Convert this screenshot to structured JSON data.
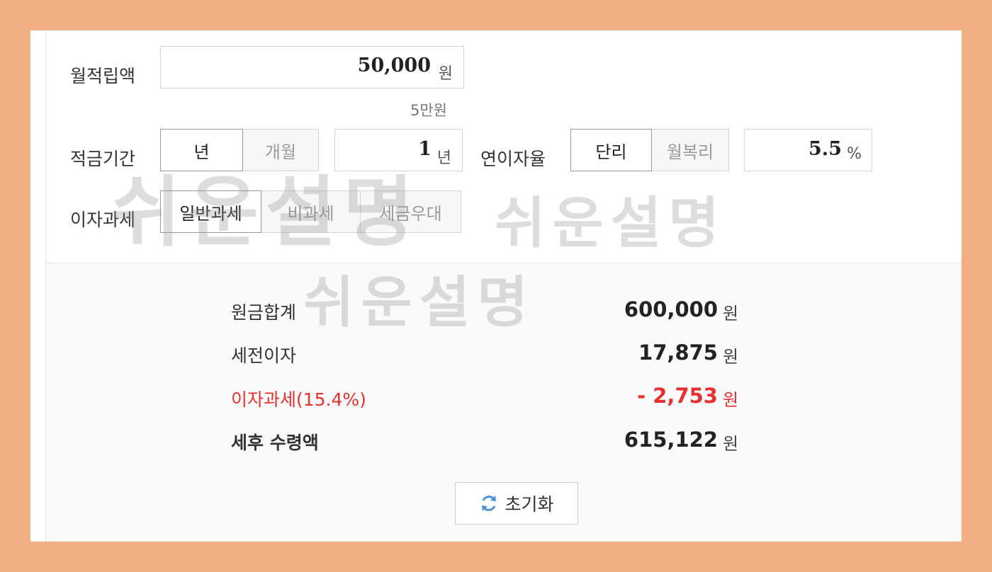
{
  "form": {
    "monthly_label": "월적립액",
    "monthly_value": "50,000",
    "monthly_unit": "원",
    "monthly_hint": "5만원",
    "period_label": "적금기간",
    "period_unit_options": [
      "년",
      "개월"
    ],
    "period_value": "1",
    "period_unit": "년",
    "rate_label": "연이자율",
    "rate_type_options": [
      "단리",
      "월복리"
    ],
    "rate_value": "5.5",
    "rate_unit": "%",
    "tax_label": "이자과세",
    "tax_options": [
      "일반과세",
      "비과세",
      "세금우대"
    ]
  },
  "results": {
    "principal_label": "원금합계",
    "principal_value": "600,000",
    "pretax_label": "세전이자",
    "pretax_value": "17,875",
    "tax_label": "이자과세(15.4%)",
    "tax_value": "- 2,753",
    "after_label": "세후 수령액",
    "after_value": "615,122",
    "unit": "원"
  },
  "reset_label": "초기화",
  "watermark": [
    "쉬운설명",
    "쉬운설명",
    "쉬운설명"
  ],
  "colors": {
    "border": "#f0b083",
    "negative": "#e8302f",
    "refresh_icon": "#4a90d9"
  }
}
